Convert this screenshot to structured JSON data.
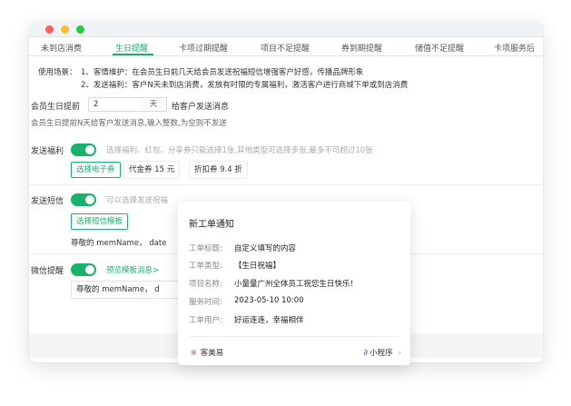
{
  "tabs": [
    {
      "label": "未到店消费"
    },
    {
      "label": "生日提醒"
    },
    {
      "label": "卡项过期提醒"
    },
    {
      "label": "项目不足提醒"
    },
    {
      "label": "券到期提醒"
    },
    {
      "label": "储值不足提醒"
    },
    {
      "label": "卡项服务后"
    }
  ],
  "active_tab": "生日提醒",
  "usage": {
    "title": "使用场景：",
    "line1": "1、客情维护：在会员生日前几天给会员发送祝福短信增强客户好感，传播品牌形象",
    "line2": "2、发送福利：客户N天未到店消费，发放有时限的专属福利，激活客户进行商城下单或到店消费"
  },
  "birthday": {
    "label": "会员生日提前",
    "value": "2",
    "unit": "天",
    "suffix": "给客户发送消息",
    "hint": "会员生日提前N天给客户发送消息,输入整数,为空则不发送"
  },
  "benefit": {
    "label": "发送福利",
    "hint": "选择福利、红包、分享券只能选择1张,其他类型可选择多张,最多不可超过10张",
    "button": "选择电子券",
    "chips": [
      "代金券 15 元",
      "折扣券 9.4 折"
    ]
  },
  "sms": {
    "label": "发送短信",
    "hint": "可以选择发送祝福",
    "button": "选择短信模板",
    "preview": "尊敬的 memName， date"
  },
  "wechat": {
    "label": "微信提醒",
    "link": "预览模板消息>",
    "input_value": "尊敬的 memName， d"
  },
  "card": {
    "title": "新工单通知",
    "rows": [
      {
        "label": "工单标题:",
        "value": "自定义填写的内容"
      },
      {
        "label": "工单类型:",
        "value": "【生日祝福】"
      },
      {
        "label": "项目名称:",
        "value": "小量量广州全体员工祝您生日快乐！"
      },
      {
        "label": "服务时间:",
        "value": "2023-05-10  10:00"
      },
      {
        "label": "工单用户:",
        "value": "好运连连，幸福相伴"
      }
    ],
    "footer_left": "客美易",
    "footer_right": "小程序"
  },
  "colors": {
    "accent": "#19b26b"
  }
}
